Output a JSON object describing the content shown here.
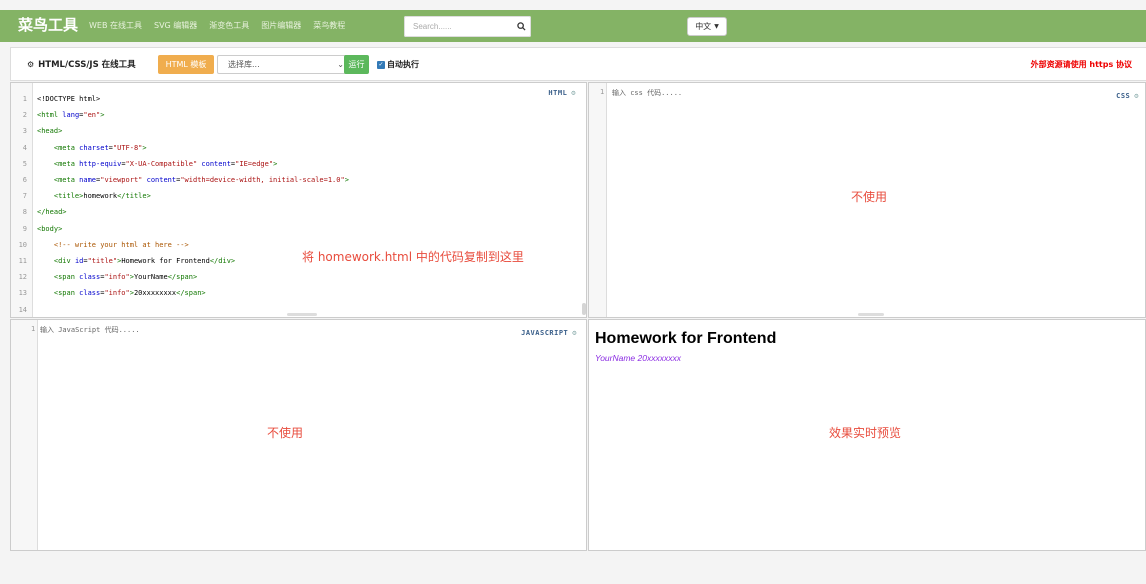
{
  "nav": {
    "brand": "菜鸟工具",
    "links": [
      "WEB 在线工具",
      "SVG 编辑器",
      "渐变色工具",
      "图片编辑器",
      "菜鸟教程"
    ],
    "search_placeholder": "Search......",
    "lang": "中文"
  },
  "toolbar": {
    "title": "HTML/CSS/JS 在线工具",
    "template_button": "HTML 模板",
    "library_select": "选择库...",
    "run_button": "运行",
    "auto_run": "自动执行",
    "external_note": "外部资源请使用 https 协议"
  },
  "html_pane": {
    "badge": "HTML",
    "overlay": "将 homework.html 中的代码复制到这里"
  },
  "css_pane": {
    "badge": "CSS",
    "placeholder": "输入 css 代码.....",
    "overlay": "不使用"
  },
  "js_pane": {
    "badge": "JAVASCRIPT",
    "placeholder": "输入 JavaScript 代码.....",
    "overlay": "不使用"
  },
  "preview": {
    "title": "Homework for Frontend",
    "info": "YourName 20xxxxxxxx",
    "overlay": "效果实时预览"
  },
  "colors": {
    "nav_bg": "#84b365",
    "template_btn": "#f0ad4e",
    "run_btn": "#5cb85c",
    "overlay_text": "#e84c3d",
    "info_text": "#8a2be2"
  }
}
